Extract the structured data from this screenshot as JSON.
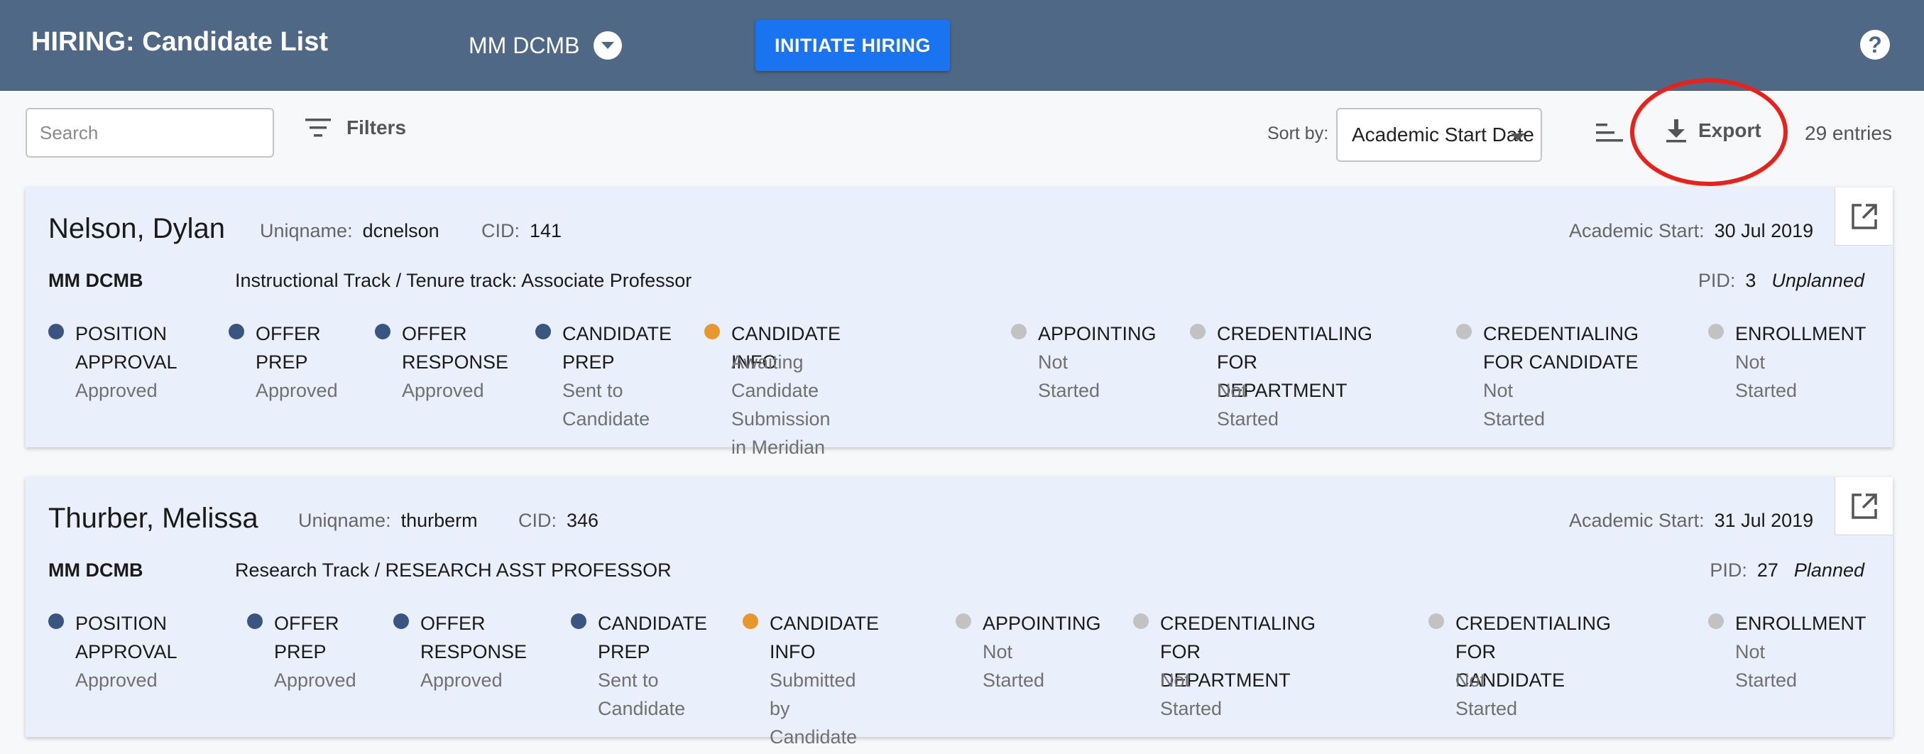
{
  "header": {
    "title": "HIRING: Candidate List",
    "department": "MM DCMB",
    "initiate_label": "INITIATE HIRING",
    "help_icon": "help-circle-icon",
    "help_glyph": "?"
  },
  "toolbar": {
    "search_placeholder": "Search",
    "filters_label": "Filters",
    "sort_label": "Sort by:",
    "sort_value": "Academic Start Date",
    "export_label": "Export",
    "entries": "29 entries"
  },
  "colors": {
    "header_bg": "#4e6886",
    "primary_button": "#1a73f0",
    "complete": "#3a5580",
    "in_progress": "#e8962e",
    "not_started": "#c2c2c2",
    "highlight_ring": "#e8221b"
  },
  "candidates": [
    {
      "name": "Nelson, Dylan",
      "uniqname_label": "Uniqname:",
      "uniqname": "dcnelson",
      "cid_label": "CID:",
      "cid": "141",
      "academic_start_label": "Academic Start:",
      "academic_start": "30 Jul 2019",
      "department": "MM DCMB",
      "track": "Instructional Track / Tenure track: Associate Professor",
      "pid_label": "PID:",
      "pid": "3",
      "plan_status": "Unplanned",
      "steps": [
        {
          "name": "POSITION\nAPPROVAL",
          "status": "Approved",
          "state": "complete"
        },
        {
          "name": "OFFER\nPREP",
          "status": "Approved",
          "state": "complete"
        },
        {
          "name": "OFFER\nRESPONSE",
          "status": "Approved",
          "state": "complete"
        },
        {
          "name": "CANDIDATE\nPREP",
          "status": "Sent to\nCandidate",
          "state": "complete"
        },
        {
          "name": "CANDIDATE INFO",
          "status": "Awaiting Candidate\nSubmission in Meridian",
          "state": "in_progress"
        },
        {
          "name": "APPOINTING",
          "status": "Not Started",
          "state": "not_started"
        },
        {
          "name": "CREDENTIALING FOR\nDEPARTMENT",
          "status": "Not Started",
          "state": "not_started"
        },
        {
          "name": "CREDENTIALING\nFOR CANDIDATE",
          "status": "Not Started",
          "state": "not_started"
        },
        {
          "name": "ENROLLMENT",
          "status": "Not Started",
          "state": "not_started"
        }
      ]
    },
    {
      "name": "Thurber, Melissa",
      "uniqname_label": "Uniqname:",
      "uniqname": "thurberm",
      "cid_label": "CID:",
      "cid": "346",
      "academic_start_label": "Academic Start:",
      "academic_start": "31 Jul 2019",
      "department": "MM DCMB",
      "track": "Research Track / RESEARCH ASST PROFESSOR",
      "pid_label": "PID:",
      "pid": "27",
      "plan_status": "Planned",
      "steps": [
        {
          "name": "POSITION\nAPPROVAL",
          "status": "Approved",
          "state": "complete"
        },
        {
          "name": "OFFER\nPREP",
          "status": "Approved",
          "state": "complete"
        },
        {
          "name": "OFFER\nRESPONSE",
          "status": "Approved",
          "state": "complete"
        },
        {
          "name": "CANDIDATE\nPREP",
          "status": "Sent to\nCandidate",
          "state": "complete"
        },
        {
          "name": "CANDIDATE\nINFO",
          "status": "Submitted by\nCandidate",
          "state": "in_progress"
        },
        {
          "name": "APPOINTING",
          "status": "Not Started",
          "state": "not_started"
        },
        {
          "name": "CREDENTIALING FOR\nDEPARTMENT",
          "status": "Not Started",
          "state": "not_started"
        },
        {
          "name": "CREDENTIALING FOR\nCANDIDATE",
          "status": "Not Started",
          "state": "not_started"
        },
        {
          "name": "ENROLLMENT",
          "status": "Not Started",
          "state": "not_started"
        }
      ]
    }
  ]
}
